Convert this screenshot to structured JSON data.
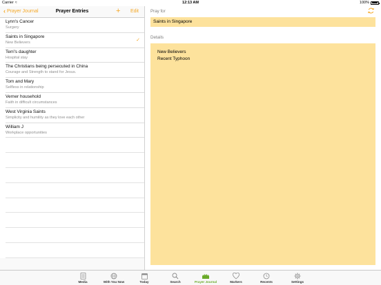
{
  "status_bar": {
    "carrier": "Carrier",
    "time": "12:13 AM",
    "battery": "100%"
  },
  "nav": {
    "back_label": "Prayer Journal",
    "title": "Prayer Entries",
    "add_label": "+",
    "edit_label": "Edit"
  },
  "entries": [
    {
      "title": "Lynn's Cancer",
      "subtitle": "Surgery",
      "selected": false
    },
    {
      "title": "Saints in Singapore",
      "subtitle": "New Believers",
      "selected": true
    },
    {
      "title": "Terri's daughter",
      "subtitle": "Hospital stay",
      "selected": false
    },
    {
      "title": "The Christians being persecuted in China",
      "subtitle": "Courage and Strength to stand for Jesus.",
      "selected": false
    },
    {
      "title": "Tom and Mary",
      "subtitle": "Selfless in relationship",
      "selected": false
    },
    {
      "title": "Verner household",
      "subtitle": "Faith in difficult circumstances",
      "selected": false
    },
    {
      "title": "West Virginia Saints",
      "subtitle": "Simplicity and humility as they love each other",
      "selected": false
    },
    {
      "title": "William J",
      "subtitle": "Workplace opportunities",
      "selected": false
    }
  ],
  "detail": {
    "pray_for_label": "Pray for",
    "pray_for_value": "Saints in Singapore",
    "details_label": "Details",
    "details_lines": [
      "New Believers",
      "Recent Typhoon"
    ]
  },
  "tabs": [
    {
      "label": "Media",
      "icon": "media-icon"
    },
    {
      "label": "With You Now",
      "icon": "globe-icon"
    },
    {
      "label": "Today",
      "icon": "calendar-icon"
    },
    {
      "label": "Search",
      "icon": "search-icon"
    },
    {
      "label": "Prayer Journal",
      "icon": "prayer-journal-icon",
      "active": true
    },
    {
      "label": "Markers",
      "icon": "heart-icon"
    },
    {
      "label": "Recents",
      "icon": "clock-icon"
    },
    {
      "label": "Settings",
      "icon": "gear-icon"
    }
  ],
  "colors": {
    "accent": "#f5a623",
    "field_bg": "#fde29c",
    "active_tab": "#6aaa2a"
  }
}
